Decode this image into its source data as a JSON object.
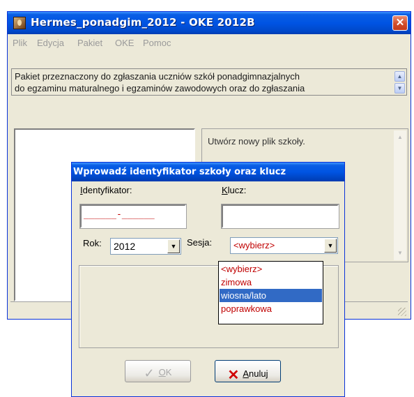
{
  "window": {
    "title": "Hermes_ponadgim_2012 - OKE 2012B",
    "close_glyph": "✕"
  },
  "menu": {
    "items": [
      "Plik",
      "Edycja",
      "Pakiet",
      "OKE",
      "Pomoc"
    ]
  },
  "description": {
    "line1": "Pakiet przeznaczony do zgłaszania uczniów szkół ponadgimnazjalnych",
    "line2": "do egzaminu maturalnego i egzaminów zawodowych oraz do zgłaszania"
  },
  "right_panel": {
    "text": "Utwórz nowy plik szkoły."
  },
  "dialog": {
    "title": "Wprowadź identyfikator szkoły oraz klucz",
    "id_label_first": "I",
    "id_label_rest": "dentyfikator:",
    "key_label_first": "K",
    "key_label_rest": "lucz:",
    "id_mask": "______-______",
    "key_value": "",
    "year_label": "Rok:",
    "year_value": "2012",
    "session_label": "Sesja:",
    "session_value": "<wybierz>",
    "session_options": [
      "<wybierz>",
      "zimowa",
      "wiosna/lato",
      "poprawkowa"
    ],
    "session_highlighted": "wiosna/lato",
    "ok_label_first": "O",
    "ok_label_rest": "K",
    "cancel_label_first": "A",
    "cancel_label_rest": "nuluj"
  },
  "icons": {
    "app": "hermes-app-icon",
    "close": "close-icon",
    "scroll_up": "scroll-up-icon",
    "scroll_down": "scroll-down-icon",
    "dropdown": "chevron-down-icon",
    "ok": "check-icon",
    "cancel": "x-icon"
  },
  "colors": {
    "titlebar": "#0054E3",
    "window_bg": "#ECE9D8",
    "mask_red": "#C00000",
    "selection": "#316AC5"
  }
}
